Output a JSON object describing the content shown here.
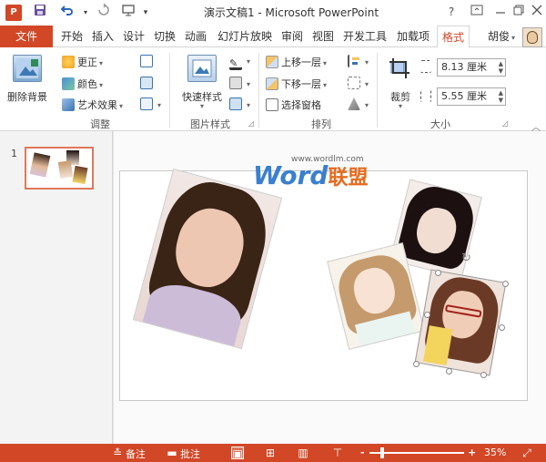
{
  "titlebar": {
    "app_icon": "P",
    "title": "演示文稿1 - Microsoft PowerPoint",
    "save_icon": "save-icon",
    "undo_icon": "undo-icon",
    "redo_icon": "redo-icon",
    "help": "?"
  },
  "tabs": {
    "file": "文件",
    "items": [
      "开始",
      "插入",
      "设计",
      "切换",
      "动画",
      "幻灯片放映",
      "审阅",
      "视图",
      "开发工具",
      "加载项",
      "格式"
    ],
    "active": "格式",
    "user": "胡俊"
  },
  "ribbon": {
    "adjust": {
      "label": "调整",
      "remove_bg": "删除背景",
      "corrections": "更正",
      "color": "颜色",
      "artistic": "艺术效果"
    },
    "styles": {
      "label": "图片样式",
      "quick_styles": "快速样式"
    },
    "arrange": {
      "label": "排列",
      "bring_forward": "上移一层",
      "send_backward": "下移一层",
      "selection_pane": "选择窗格"
    },
    "size": {
      "label": "大小",
      "crop": "裁剪",
      "height": "8.13 厘米",
      "width": "5.55 厘米"
    }
  },
  "thumbnails": {
    "slide_number": "1"
  },
  "watermark": {
    "url": "www.wordlm.com",
    "logo_word": "Word",
    "logo_cn": "联盟"
  },
  "statusbar": {
    "notes": "备注",
    "comments": "批注",
    "zoom_minus": "-",
    "zoom_plus": "+",
    "zoom_percent": "35%",
    "zoom_level": 35
  },
  "colors": {
    "accent": "#d24726",
    "selection": "#e0785a"
  }
}
